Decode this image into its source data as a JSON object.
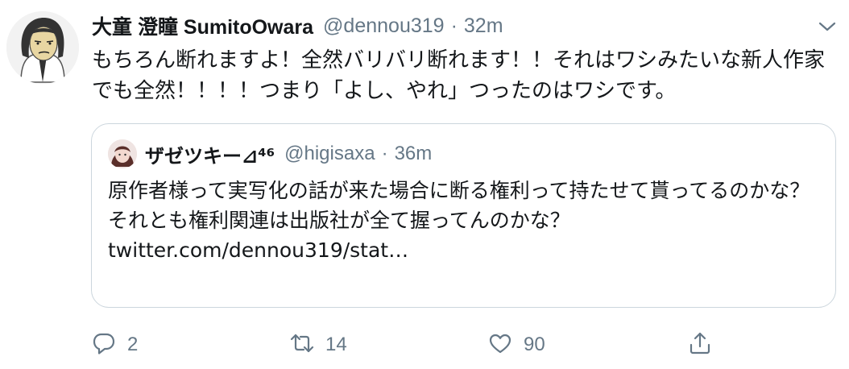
{
  "tweet": {
    "display_name": "大童 澄瞳 SumitoOwara",
    "handle": "@dennou319",
    "separator": "·",
    "time": "32m",
    "text": "もちろん断れますよ！全然バリバリ断れます！！それはワシみたいな新人作家でも全然！！！！つまり「よし、やれ」つったのはワシです。"
  },
  "quote": {
    "display_name": "ザゼツキー⊿⁴⁶",
    "handle": "@higisaxa",
    "separator": "·",
    "time": "36m",
    "text_line1": "原作者様って実写化の話が来た場合に断る権利って持たせて貰ってるのかな？",
    "text_line2": "それとも権利関連は出版社が全て握ってんのかな？ twitter.com/dennou319/stat…"
  },
  "actions": {
    "reply_count": "2",
    "retweet_count": "14",
    "like_count": "90"
  },
  "icons": {
    "caret": "chevron-down-icon",
    "reply": "reply-icon",
    "retweet": "retweet-icon",
    "like": "heart-icon",
    "share": "share-icon"
  },
  "colors": {
    "text": "#14171a",
    "secondary": "#657786",
    "border": "#ccd6dd"
  }
}
